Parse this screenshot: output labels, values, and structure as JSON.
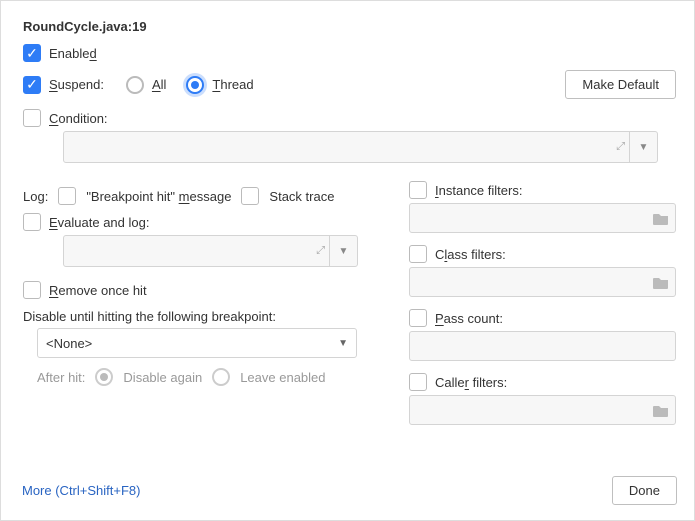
{
  "title": "RoundCycle.java:19",
  "enabled": {
    "checked": true,
    "label_pre": "Enable",
    "label_u": "d"
  },
  "suspend": {
    "checked": true,
    "label_u": "S",
    "label_post": "uspend:",
    "all": {
      "selected": false,
      "label_u": "A",
      "label_post": "ll"
    },
    "thread": {
      "selected": true,
      "label_u": "T",
      "label_post": "hread"
    }
  },
  "make_default": "Make Default",
  "condition": {
    "checked": false,
    "label_u": "C",
    "label_post": "ondition:"
  },
  "log": {
    "label": "Log:",
    "bp_hit": {
      "checked": false,
      "pre": "\"Breakpoint hit\" ",
      "u": "m",
      "post": "essage"
    },
    "stack": {
      "checked": false,
      "label": "Stack trace"
    },
    "eval": {
      "checked": false,
      "u": "E",
      "post": "valuate and log:"
    }
  },
  "remove_once": {
    "checked": false,
    "u": "R",
    "post": "emove once hit"
  },
  "disable_until": "Disable until hitting the following breakpoint:",
  "disable_select": "<None>",
  "after_hit": {
    "label": "After hit:",
    "again": "Disable again",
    "leave": "Leave enabled"
  },
  "filters": {
    "instance": {
      "checked": false,
      "u": "I",
      "post": "nstance filters:"
    },
    "class": {
      "checked": false,
      "pre": "C",
      "u": "l",
      "post": "ass filters:"
    },
    "pass": {
      "checked": false,
      "u": "P",
      "post": "ass count:"
    },
    "caller": {
      "checked": false,
      "pre": "Calle",
      "u": "r",
      "post": " filters:"
    }
  },
  "more": "More (Ctrl+Shift+F8)",
  "done": "Done"
}
